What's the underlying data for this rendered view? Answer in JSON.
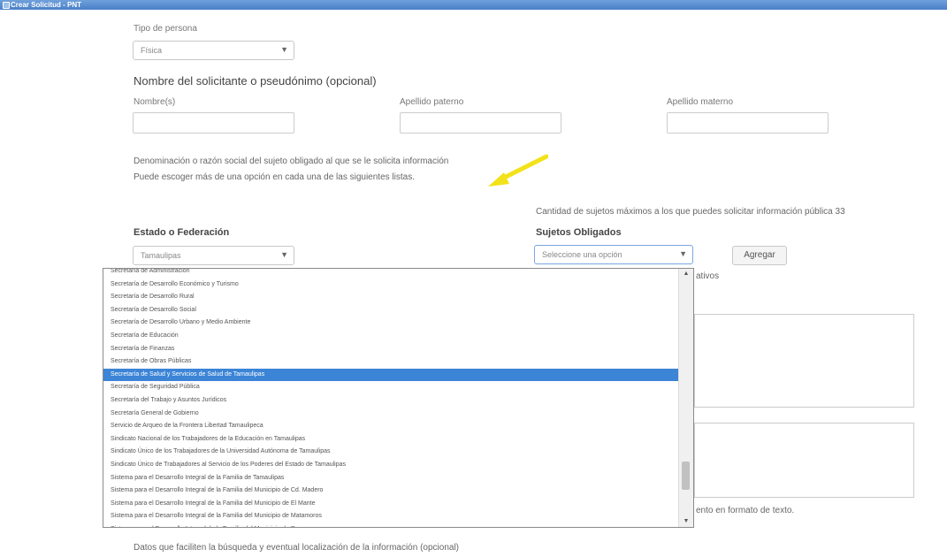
{
  "window": {
    "title": "Crear Solicitud - PNT"
  },
  "tipo_persona": {
    "label": "Tipo de persona",
    "value": "Física"
  },
  "solicitante": {
    "heading": "Nombre del solicitante o pseudónimo (opcional)",
    "nombre_label": "Nombre(s)",
    "ap_paterno_label": "Apellido paterno",
    "ap_materno_label": "Apellido materno"
  },
  "denominacion": {
    "line1": "Denominación o razón social del sujeto obligado al que se le solicita información",
    "line2": "Puede escoger más de una opción en cada una de las siguientes listas."
  },
  "cantidad": {
    "text": "Cantidad de sujetos máximos a los que puedes solicitar información pública 33"
  },
  "estado": {
    "label": "Estado o Federación",
    "value": "Tamaulipas"
  },
  "sujetos": {
    "label": "Sujetos Obligados",
    "placeholder": "Seleccione una opción",
    "add_button": "Agregar"
  },
  "partial": {
    "right_text": "ativos",
    "formato": "ento en formato de texto."
  },
  "datos_localizacion": "Datos que faciliten la búsqueda y eventual localización de la información (opcional)",
  "dropdown": {
    "items": [
      "Secretaría de Administración",
      "Secretaría de Desarrollo Económico y Turismo",
      "Secretaría de Desarrollo Rural",
      "Secretaría de Desarrollo Social",
      "Secretaría de Desarrollo Urbano y Medio Ambiente",
      "Secretaría de Educación",
      "Secretaría de Finanzas",
      "Secretaría de Obras Públicas",
      "Secretaría de Salud y Servicios de Salud de Tamaulipas",
      "Secretaría de Seguridad Pública",
      "Secretaría del Trabajo y Asuntos Jurídicos",
      "Secretaría General de Gobierno",
      "Servicio de Arqueo de la Frontera Libertad Tamaulipeca",
      "Sindicato Nacional de los Trabajadores de la Educación en Tamaulipas",
      "Sindicato Único de los Trabajadores de la Universidad Autónoma de Tamaulipas",
      "Sindicato Único de Trabajadores al Servicio de los Poderes del Estado de Tamaulipas",
      "Sistema para el Desarrollo Integral de la Familia de Tamaulipas",
      "Sistema para el Desarrollo Integral de la Familia del Municipio de Cd. Madero",
      "Sistema para el Desarrollo Integral de la Familia del Municipio de El Mante",
      "Sistema para el Desarrollo Integral de la Familia del Municipio de Matamoros",
      "Sistema para el Desarrollo Integral de la Familia del Municipio de Reynosa"
    ],
    "selected_index": 8
  },
  "colors": {
    "selection": "#3b84d6",
    "arrow": "#f3e21a",
    "titlebar": "#4a7fc8"
  }
}
